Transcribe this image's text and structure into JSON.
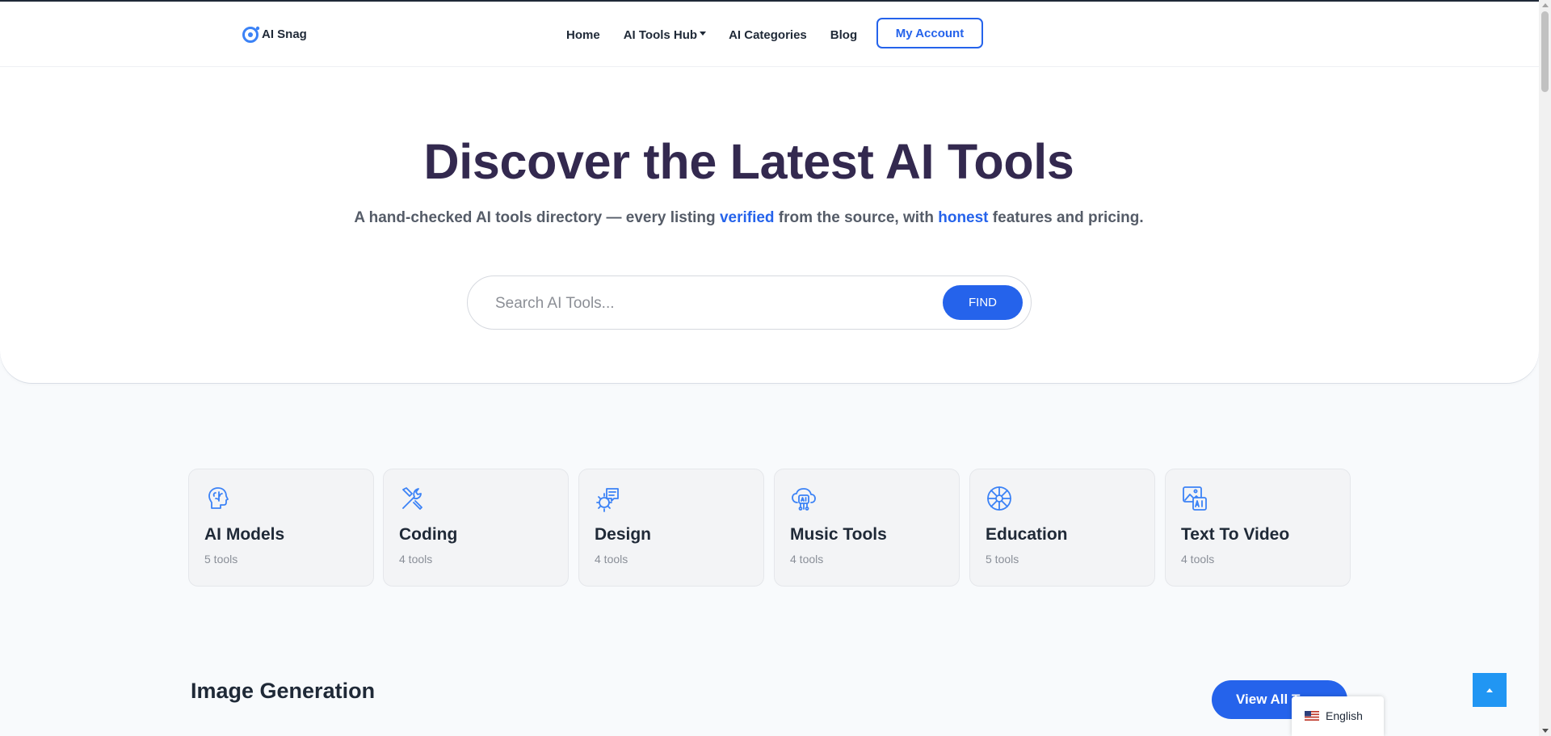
{
  "brand": {
    "name": "AI Snag"
  },
  "nav": {
    "home": "Home",
    "tools_hub": "AI Tools Hub",
    "categories": "AI Categories",
    "blog": "Blog",
    "account": "My Account"
  },
  "hero": {
    "title": "Discover the Latest AI Tools",
    "subtitle_part1": "A hand-checked AI tools directory — every listing ",
    "subtitle_hl1": "verified",
    "subtitle_part2": " from the source, with ",
    "subtitle_hl2": "honest",
    "subtitle_part3": " features and pricing."
  },
  "search": {
    "placeholder": "Search AI Tools...",
    "value": "",
    "button": "FIND"
  },
  "categories": [
    {
      "title": "AI Models",
      "count": "5 tools",
      "icon": "brain-icon"
    },
    {
      "title": "Coding",
      "count": "4 tools",
      "icon": "tools-icon"
    },
    {
      "title": "Design",
      "count": "4 tools",
      "icon": "design-icon"
    },
    {
      "title": "Music Tools",
      "count": "4 tools",
      "icon": "cloud-ai-icon"
    },
    {
      "title": "Education",
      "count": "5 tools",
      "icon": "aperture-icon"
    },
    {
      "title": "Text To Video",
      "count": "4 tools",
      "icon": "image-ai-icon"
    }
  ],
  "section": {
    "title": "Image Generation",
    "view_all": "View All T"
  },
  "language": {
    "label": "English"
  },
  "colors": {
    "accent": "#2563eb",
    "title": "#33294f",
    "card_bg": "#f3f4f6"
  }
}
